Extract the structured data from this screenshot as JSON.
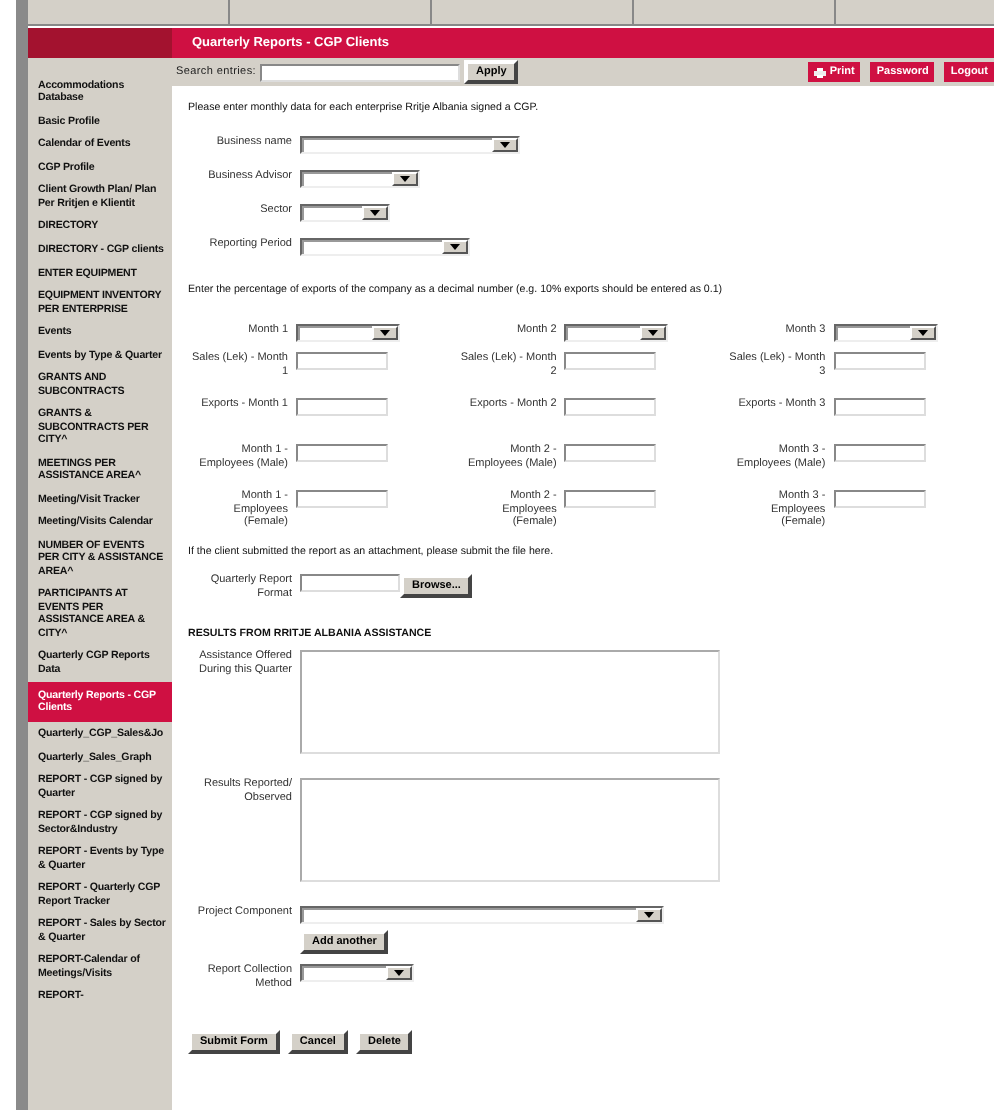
{
  "header": {
    "title": "Quarterly Reports - CGP Clients"
  },
  "search": {
    "label": "Search entries:",
    "button": "Apply"
  },
  "top_links": [
    {
      "label": "Print",
      "kind": "print"
    },
    {
      "label": "Password",
      "kind": "plain"
    },
    {
      "label": "Logout",
      "kind": "plain"
    }
  ],
  "sidebar": {
    "items": [
      {
        "label": "Accommodations Database",
        "selected": false
      },
      {
        "label": "Basic Profile",
        "selected": false
      },
      {
        "label": "Calendar of Events",
        "selected": false
      },
      {
        "label": "CGP Profile",
        "selected": false
      },
      {
        "label": "Client Growth Plan/ Plan Per Rritjen e Klientit",
        "selected": false
      },
      {
        "label": "DIRECTORY",
        "selected": false
      },
      {
        "label": "DIRECTORY - CGP clients",
        "selected": false
      },
      {
        "label": "ENTER EQUIPMENT",
        "selected": false
      },
      {
        "label": "EQUIPMENT INVENTORY PER ENTERPRISE",
        "selected": false
      },
      {
        "label": "Events",
        "selected": false
      },
      {
        "label": "Events by Type & Quarter",
        "selected": false
      },
      {
        "label": "GRANTS AND SUBCONTRACTS",
        "selected": false
      },
      {
        "label": "GRANTS & SUBCONTRACTS PER CITY^",
        "selected": false
      },
      {
        "label": "MEETINGS PER ASSISTANCE AREA^",
        "selected": false
      },
      {
        "label": "Meeting/Visit Tracker",
        "selected": false
      },
      {
        "label": "Meeting/Visits Calendar",
        "selected": false
      },
      {
        "label": "NUMBER OF EVENTS PER CITY & ASSISTANCE AREA^",
        "selected": false
      },
      {
        "label": "PARTICIPANTS AT EVENTS PER ASSISTANCE AREA & CITY^",
        "selected": false
      },
      {
        "label": "Quarterly CGP Reports Data",
        "selected": false
      },
      {
        "label": "Quarterly Reports - CGP Clients",
        "selected": true
      },
      {
        "label": "Quarterly_CGP_Sales&Jo",
        "selected": false
      },
      {
        "label": "Quarterly_Sales_Graph",
        "selected": false
      },
      {
        "label": "REPORT - CGP signed by Quarter",
        "selected": false
      },
      {
        "label": "REPORT - CGP signed by Sector&Industry",
        "selected": false
      },
      {
        "label": "REPORT - Events by Type & Quarter",
        "selected": false
      },
      {
        "label": "REPORT - Quarterly CGP Report Tracker",
        "selected": false
      },
      {
        "label": "REPORT - Sales by Sector & Quarter",
        "selected": false
      },
      {
        "label": "REPORT-Calendar of Meetings/Visits",
        "selected": false
      },
      {
        "label": "REPORT-",
        "selected": false
      }
    ]
  },
  "form": {
    "intro": "Please enter monthly data for each enterprise Rritje Albania signed a CGP.",
    "fields": [
      {
        "label": "Business name",
        "kind": "wide"
      },
      {
        "label": "Business Advisor",
        "kind": "medium"
      },
      {
        "label": "Sector",
        "kind": "small"
      },
      {
        "label": "Reporting Period",
        "kind": "long"
      }
    ],
    "exports_note": "Enter the percentage of exports of the company as a decimal number (e.g. 10% exports should be entered as 0.1)",
    "months": [
      {
        "label": "Month 1",
        "inputs": [
          "Sales (Lek) - Month 1",
          "Exports - Month 1",
          "Month 1 - Employees (Male)",
          "Month 1 - Employees (Female)"
        ]
      },
      {
        "label": "Month 2",
        "inputs": [
          "Sales (Lek) - Month 2",
          "Exports - Month 2",
          "Month 2 - Employees (Male)",
          "Month 2 - Employees (Female)"
        ]
      },
      {
        "label": "Month 3",
        "inputs": [
          "Sales (Lek) - Month 3",
          "Exports - Month 3",
          "Month 3 - Employees (Male)",
          "Month 3 - Employees (Female)"
        ]
      }
    ],
    "attachment_note": "If the client submitted the report as an attachment, please submit the file here.",
    "file_field": {
      "label": "Quarterly Report Format",
      "button": "Browse..."
    },
    "results_heading": "RESULTS FROM RRITJE ALBANIA ASSISTANCE",
    "text_areas": [
      {
        "label": "Assistance Offered During this Quarter"
      },
      {
        "label": "Results Reported/ Observed"
      }
    ],
    "project_component": {
      "label": "Project Component",
      "button": "Add another"
    },
    "collection": {
      "label": "Report Collection Method"
    },
    "buttons": [
      "Submit Form",
      "Cancel",
      "Delete"
    ]
  }
}
